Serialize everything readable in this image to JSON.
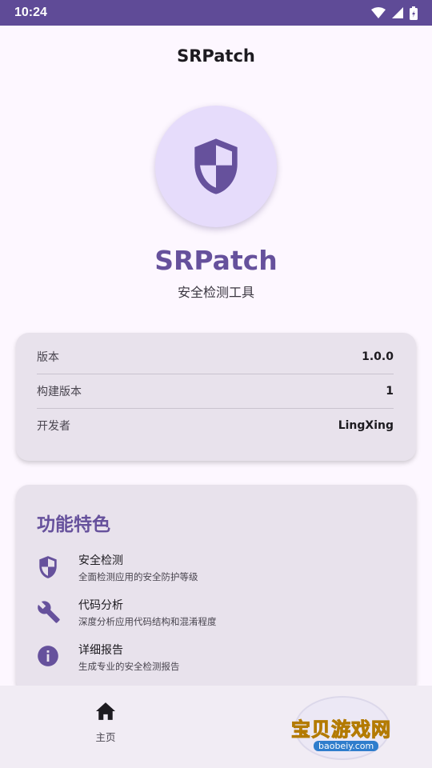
{
  "status_bar": {
    "time": "10:24"
  },
  "app_bar": {
    "title": "SRPatch"
  },
  "hero": {
    "title": "SRPatch",
    "subtitle": "安全检测工具"
  },
  "info": {
    "rows": [
      {
        "label": "版本",
        "value": "1.0.0"
      },
      {
        "label": "构建版本",
        "value": "1"
      },
      {
        "label": "开发者",
        "value": "LingXing"
      }
    ]
  },
  "features": {
    "title": "功能特色",
    "items": [
      {
        "name": "安全检测",
        "desc": "全面检测应用的安全防护等级",
        "icon": "shield-icon"
      },
      {
        "name": "代码分析",
        "desc": "深度分析应用代码结构和混淆程度",
        "icon": "wrench-icon"
      },
      {
        "name": "详细报告",
        "desc": "生成专业的安全检测报告",
        "icon": "info-icon"
      }
    ]
  },
  "bottom_nav": {
    "home_label": "主页"
  },
  "watermark": {
    "text": "宝贝游戏网",
    "url": "baobeiy.com"
  },
  "colors": {
    "primary": "#66519c",
    "status_bar": "#5f4b97",
    "background": "#fdf7ff",
    "card": "#e8e2ec"
  }
}
